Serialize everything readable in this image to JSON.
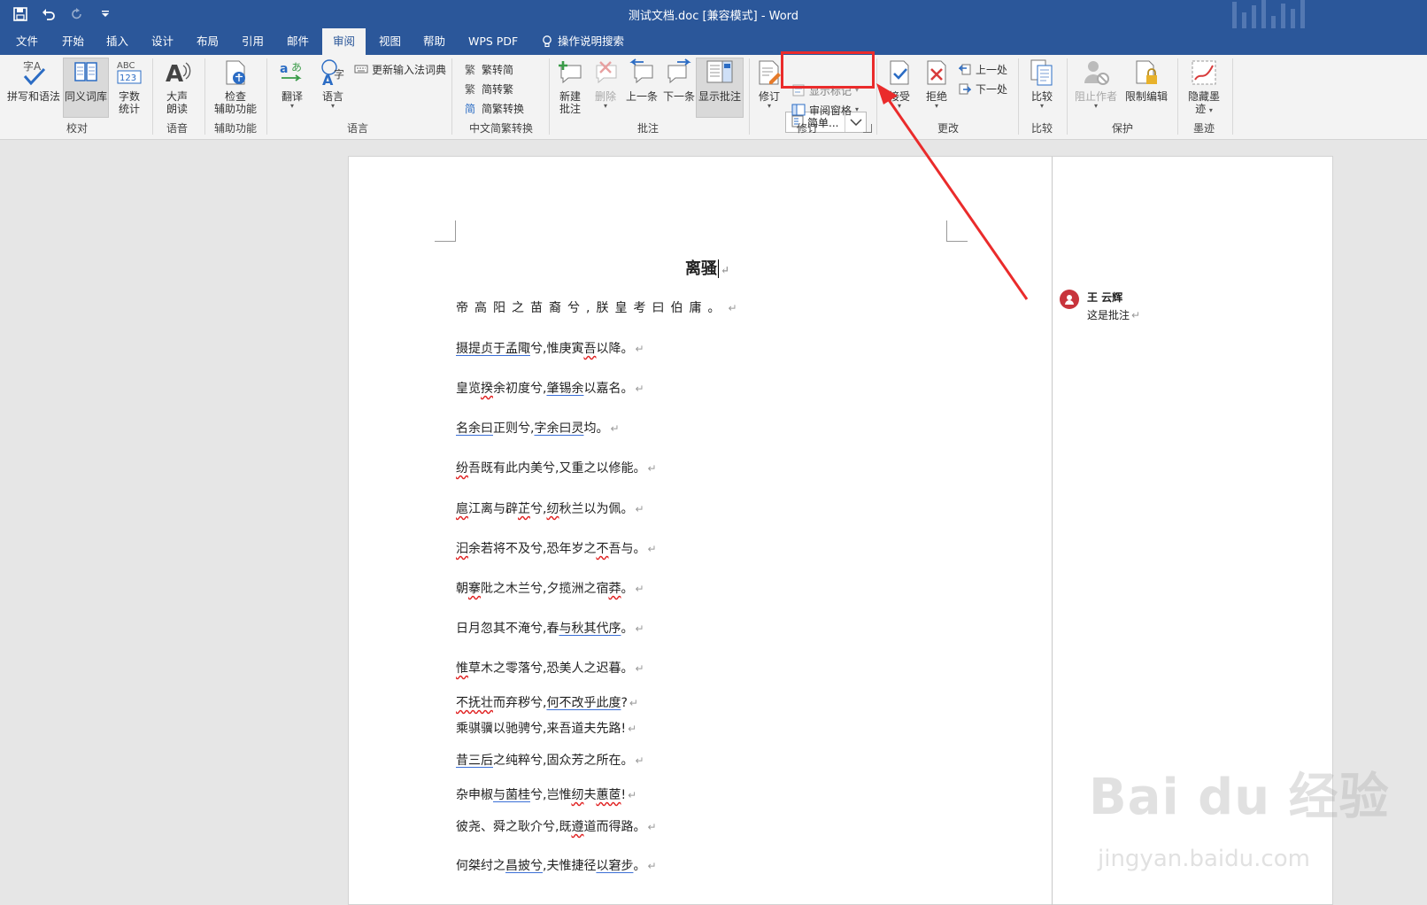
{
  "window": {
    "title": "测试文档.doc [兼容模式] - Word"
  },
  "quick_access": [
    "save-icon",
    "undo-icon",
    "redo-icon",
    "customize-icon"
  ],
  "tabs": [
    {
      "label": "文件"
    },
    {
      "label": "开始"
    },
    {
      "label": "插入"
    },
    {
      "label": "设计"
    },
    {
      "label": "布局"
    },
    {
      "label": "引用"
    },
    {
      "label": "邮件"
    },
    {
      "label": "审阅"
    },
    {
      "label": "视图"
    },
    {
      "label": "帮助"
    },
    {
      "label": "WPS PDF"
    }
  ],
  "tell_me": "操作说明搜索",
  "ribbon": {
    "proofing": {
      "spell": "拼写和语法",
      "thesaurus": "同义词库",
      "wordcount_1": "字数",
      "wordcount_2": "统计",
      "label": "校对"
    },
    "speech": {
      "read_1": "大声",
      "read_2": "朗读",
      "label": "语音"
    },
    "accessibility": {
      "check_1": "检查",
      "check_2": "辅助功能",
      "label": "辅助功能"
    },
    "language": {
      "translate": "翻译",
      "language": "语言",
      "update_ime": "更新输入法词典",
      "label": "语言"
    },
    "chinese": {
      "t2s": "繁转简",
      "s2t": "简转繁",
      "convert": "简繁转换",
      "label": "中文简繁转换"
    },
    "comments": {
      "new_1": "新建",
      "new_2": "批注",
      "delete": "删除",
      "prev": "上一条",
      "next": "下一条",
      "show": "显示批注",
      "label": "批注"
    },
    "tracking": {
      "track": "修订",
      "markup_value": "简单...",
      "show_markup": "显示标记",
      "pane": "审阅窗格",
      "label": "修订"
    },
    "changes": {
      "accept": "接受",
      "reject": "拒绝",
      "prev": "上一处",
      "next": "下一处",
      "label": "更改"
    },
    "compare": {
      "compare": "比较",
      "label": "比较"
    },
    "protect": {
      "block": "阻止作者",
      "restrict": "限制编辑",
      "label": "保护"
    },
    "ink": {
      "hide_1": "隐藏墨",
      "hide_2": "迹",
      "label": "墨迹"
    }
  },
  "document": {
    "title": "离骚",
    "paragraphs": [
      [
        {
          "t": "帝高阳之苗裔兮,朕皇考曰伯庸。",
          "s": "spaced"
        }
      ],
      [
        {
          "t": "摄提贞于孟陬",
          "s": "blue"
        },
        {
          "t": "兮,惟庚寅"
        },
        {
          "t": "吾",
          "s": "red"
        },
        {
          "t": "以降。"
        }
      ],
      [
        {
          "t": "皇览"
        },
        {
          "t": "揆",
          "s": "red"
        },
        {
          "t": "余初度兮,"
        },
        {
          "t": "肇锡余",
          "s": "blue"
        },
        {
          "t": "以嘉名。"
        }
      ],
      [
        {
          "t": "名余曰",
          "s": "blue"
        },
        {
          "t": "正则兮,"
        },
        {
          "t": "字余曰灵",
          "s": "blue"
        },
        {
          "t": "均。"
        }
      ],
      [
        {
          "t": "纷",
          "s": "red"
        },
        {
          "t": "吾既有此内美兮,又重之以修能。"
        }
      ],
      [
        {
          "t": "扈",
          "s": "red"
        },
        {
          "t": "江离与辟"
        },
        {
          "t": "芷",
          "s": "red"
        },
        {
          "t": "兮,"
        },
        {
          "t": "纫",
          "s": "red"
        },
        {
          "t": "秋兰以为佩。"
        }
      ],
      [
        {
          "t": "汩",
          "s": "red"
        },
        {
          "t": "余若将不及兮,恐年岁之"
        },
        {
          "t": "不",
          "s": "red"
        },
        {
          "t": "吾与。"
        }
      ],
      [
        {
          "t": "朝"
        },
        {
          "t": "搴",
          "s": "red"
        },
        {
          "t": "阰之木兰兮,夕揽洲之宿"
        },
        {
          "t": "莽",
          "s": "red"
        },
        {
          "t": "。"
        }
      ],
      [
        {
          "t": "日月忽其不淹兮,春"
        },
        {
          "t": "与秋其代序",
          "s": "blue"
        },
        {
          "t": "。"
        }
      ],
      [
        {
          "t": "惟",
          "s": "red"
        },
        {
          "t": "草木之零落兮,恐美人之迟暮。"
        }
      ],
      [
        {
          "t": "不抚壮",
          "s": "red"
        },
        {
          "t": "而弃秽兮,"
        },
        {
          "t": "何不改乎此度",
          "s": "blue"
        },
        {
          "t": "?"
        }
      ],
      [
        {
          "t": "乘骐骥以驰骋兮,来吾道夫先路!"
        }
      ],
      [
        {
          "t": "昔三后",
          "s": "blue"
        },
        {
          "t": "之纯粹兮,固众芳之所在。"
        }
      ],
      [
        {
          "t": "杂申椒"
        },
        {
          "t": "与菌桂",
          "s": "blue"
        },
        {
          "t": "兮,岂惟"
        },
        {
          "t": "纫",
          "s": "red"
        },
        {
          "t": "夫"
        },
        {
          "t": "蕙茝",
          "s": "red"
        },
        {
          "t": "!"
        }
      ],
      [
        {
          "t": "彼尧、舜之耿介兮,既"
        },
        {
          "t": "遵",
          "s": "red"
        },
        {
          "t": "道而得路。"
        }
      ],
      [
        {
          "t": "何桀纣之"
        },
        {
          "t": "昌披兮",
          "s": "blue"
        },
        {
          "t": ",夫惟捷径"
        },
        {
          "t": "以窘步",
          "s": "blue"
        },
        {
          "t": "。"
        }
      ]
    ],
    "paragraph_mark": "↵"
  },
  "comment": {
    "author": "王 云辉",
    "text": "这是批注"
  },
  "watermark": {
    "line1": "Bai du 经验",
    "line2": "jingyan.baidu.com"
  },
  "colors": {
    "brand": "#2b579a",
    "highlight": "#ea2b2b",
    "avatar": "#c8343c"
  }
}
